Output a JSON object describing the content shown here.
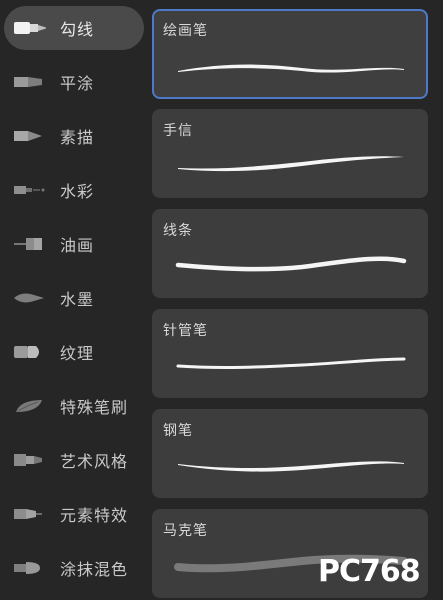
{
  "sidebar": {
    "items": [
      {
        "label": "勾线",
        "icon": "brush-pen-icon",
        "active": true
      },
      {
        "label": "平涂",
        "icon": "flat-brush-icon",
        "active": false
      },
      {
        "label": "素描",
        "icon": "pencil-icon",
        "active": false
      },
      {
        "label": "水彩",
        "icon": "watercolor-brush-icon",
        "active": false
      },
      {
        "label": "油画",
        "icon": "oil-brush-icon",
        "active": false
      },
      {
        "label": "水墨",
        "icon": "ink-brush-icon",
        "active": false
      },
      {
        "label": "纹理",
        "icon": "texture-brush-icon",
        "active": false
      },
      {
        "label": "特殊笔刷",
        "icon": "leaf-brush-icon",
        "active": false
      },
      {
        "label": "艺术风格",
        "icon": "art-brush-icon",
        "active": false
      },
      {
        "label": "元素特效",
        "icon": "effect-brush-icon",
        "active": false
      },
      {
        "label": "涂抹混色",
        "icon": "smudge-brush-icon",
        "active": false
      }
    ]
  },
  "brushes": [
    {
      "name": "绘画笔",
      "selected": true
    },
    {
      "name": "手信",
      "selected": false
    },
    {
      "name": "线条",
      "selected": false
    },
    {
      "name": "针管笔",
      "selected": false
    },
    {
      "name": "钢笔",
      "selected": false
    },
    {
      "name": "马克笔",
      "selected": false
    }
  ],
  "watermark": {
    "text": "PC768"
  },
  "colors": {
    "background": "#262626",
    "card": "#3d3d3d",
    "active_pill": "#4a4a4a",
    "selection_border": "#4f79c8",
    "text": "#d8d8d8"
  }
}
